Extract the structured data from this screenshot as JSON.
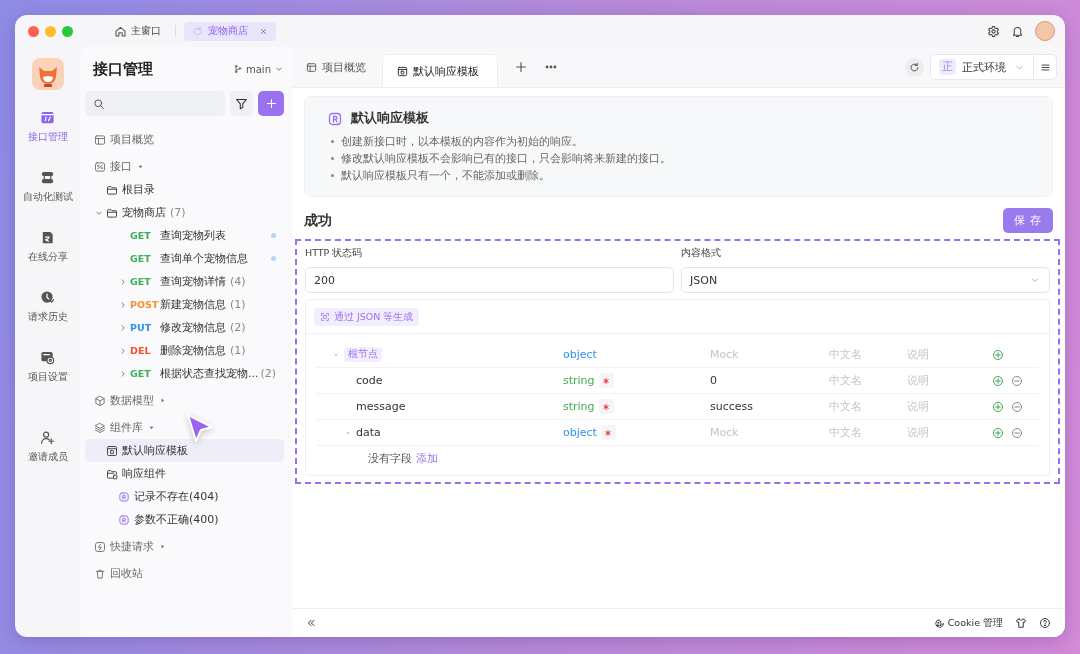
{
  "window": {
    "tabs": [
      {
        "label": "主窗口",
        "selected": false,
        "closable": false
      },
      {
        "label": "宠物商店",
        "selected": true,
        "closable": true
      }
    ]
  },
  "rail": {
    "items": [
      {
        "label": "接口管理",
        "selected": true
      },
      {
        "label": "自动化测试",
        "selected": false
      },
      {
        "label": "在线分享",
        "selected": false
      },
      {
        "label": "请求历史",
        "selected": false
      },
      {
        "label": "项目设置",
        "selected": false
      },
      {
        "label": "邀请成员",
        "selected": false
      }
    ]
  },
  "sidebar": {
    "title": "接口管理",
    "branch": "main",
    "tree": [
      {
        "kind": "section",
        "label": "项目概览",
        "selected": false
      },
      {
        "kind": "section",
        "label": "接口",
        "selected": false,
        "expanded": true,
        "children": [
          {
            "kind": "folder",
            "label": "根目录",
            "selected": false
          },
          {
            "kind": "folder",
            "label": "宠物商店",
            "count": "(7)",
            "selected": false,
            "expanded": true,
            "children": [
              {
                "kind": "endpoint",
                "method": "GET",
                "color": "#3fae55",
                "label": "查询宠物列表",
                "selected": false,
                "unsaved": true
              },
              {
                "kind": "endpoint",
                "method": "GET",
                "color": "#3fae55",
                "label": "查询单个宠物信息",
                "selected": false,
                "unsaved": true
              },
              {
                "kind": "endpoint",
                "method": "GET",
                "color": "#3fae55",
                "label": "查询宠物详情",
                "count": "(4)",
                "selected": false,
                "expanded": false
              },
              {
                "kind": "endpoint",
                "method": "POST",
                "color": "#f5902a",
                "label": "新建宠物信息",
                "count": "(1)",
                "selected": false,
                "expanded": false
              },
              {
                "kind": "endpoint",
                "method": "PUT",
                "color": "#2e90f0",
                "label": "修改宠物信息",
                "count": "(2)",
                "selected": false,
                "expanded": false
              },
              {
                "kind": "endpoint",
                "method": "DEL",
                "color": "#f0502e",
                "label": "删除宠物信息",
                "count": "(1)",
                "selected": false,
                "expanded": false
              },
              {
                "kind": "endpoint",
                "method": "GET",
                "color": "#3fae55",
                "label": "根据状态查找宠物...",
                "count": "(2)",
                "selected": false,
                "expanded": false
              }
            ]
          }
        ]
      },
      {
        "kind": "section",
        "label": "数据模型",
        "selected": false,
        "expanded": false
      },
      {
        "kind": "section",
        "label": "组件库",
        "selected": false,
        "expanded": true,
        "children": [
          {
            "kind": "template",
            "label": "默认响应模板",
            "selected": true
          },
          {
            "kind": "response-folder",
            "label": "响应组件",
            "selected": false,
            "children": [
              {
                "kind": "response",
                "label": "记录不存在(404)",
                "selected": false
              },
              {
                "kind": "response",
                "label": "参数不正确(400)",
                "selected": false
              }
            ]
          }
        ]
      },
      {
        "kind": "section",
        "label": "快捷请求",
        "selected": false,
        "expanded": false
      },
      {
        "kind": "section",
        "label": "回收站",
        "selected": false
      }
    ]
  },
  "main": {
    "tabs": [
      {
        "label": "项目概览",
        "selected": false
      },
      {
        "label": "默认响应模板",
        "selected": true
      }
    ],
    "environment": {
      "badge": "正",
      "label": "正式环境"
    },
    "info": {
      "title": "默认响应模板",
      "bullets": [
        "创建新接口时，以本模板的内容作为初始的响应。",
        "修改默认响应模板不会影响已有的接口，只会影响将来新建的接口。",
        "默认响应模板只有一个，不能添加或删除。"
      ]
    },
    "response": {
      "name": "成功",
      "save": "保 存",
      "status": {
        "label": "HTTP 状态码",
        "value": "200"
      },
      "format": {
        "label": "内容格式",
        "value": "JSON"
      },
      "generate": "通过 JSON 等生成",
      "schema": {
        "name": "根节点",
        "type": "object",
        "color": "#2e90f0",
        "mock_placeholder": "Mock",
        "title_placeholder": "中文名",
        "description_placeholder": "说明",
        "expanded": true,
        "removable": false,
        "required": false,
        "children": [
          {
            "name": "code",
            "type": "string",
            "color": "#3fae55",
            "required": true,
            "mock": "0",
            "title_placeholder": "中文名",
            "description_placeholder": "说明",
            "removable": true
          },
          {
            "name": "message",
            "type": "string",
            "color": "#3fae55",
            "required": true,
            "mock": "success",
            "title_placeholder": "中文名",
            "description_placeholder": "说明",
            "removable": true
          },
          {
            "name": "data",
            "type": "object",
            "color": "#2e90f0",
            "required": true,
            "mock_placeholder": "Mock",
            "title_placeholder": "中文名",
            "description_placeholder": "说明",
            "removable": true,
            "expanded": true,
            "empty_text": "没有字段",
            "empty_action": "添加"
          }
        ]
      }
    }
  },
  "footer": {
    "cookie": "Cookie 管理"
  }
}
